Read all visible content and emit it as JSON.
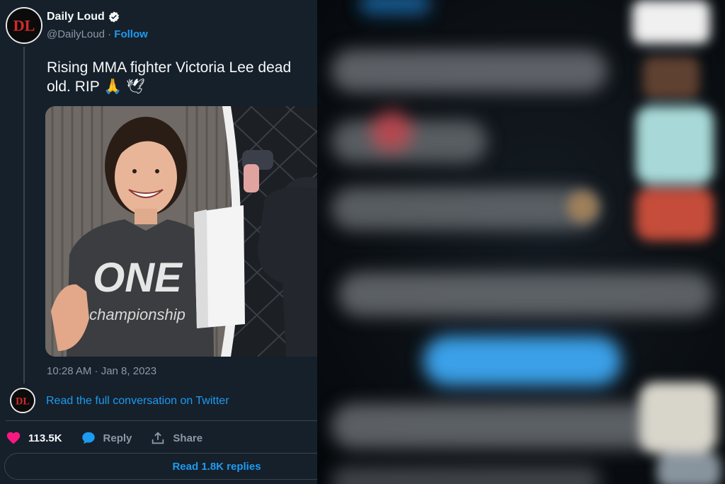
{
  "author": {
    "name": "Daily Loud",
    "handle": "@DailyLoud",
    "separator": "·",
    "follow_label": "Follow",
    "verified_icon": "verified-badge-icon"
  },
  "tweet": {
    "text": "Rising MMA fighter Victoria Lee dead\nold. RIP 🙏 🕊",
    "media": {
      "shirt_text_logo": "ONE",
      "shirt_text_sub": "championship"
    },
    "timestamp": "10:28 AM · Jan 8, 2023",
    "read_conversation_label": "Read the full conversation on Twitter"
  },
  "actions": {
    "like_count": "113.5K",
    "reply_label": "Reply",
    "share_label": "Share"
  },
  "read_replies_label": "Read 1.8K replies",
  "colors": {
    "background": "#15202b",
    "accent": "#1d9bf0",
    "like": "#f91880",
    "muted": "#8b98a5",
    "divider": "#38444d"
  }
}
